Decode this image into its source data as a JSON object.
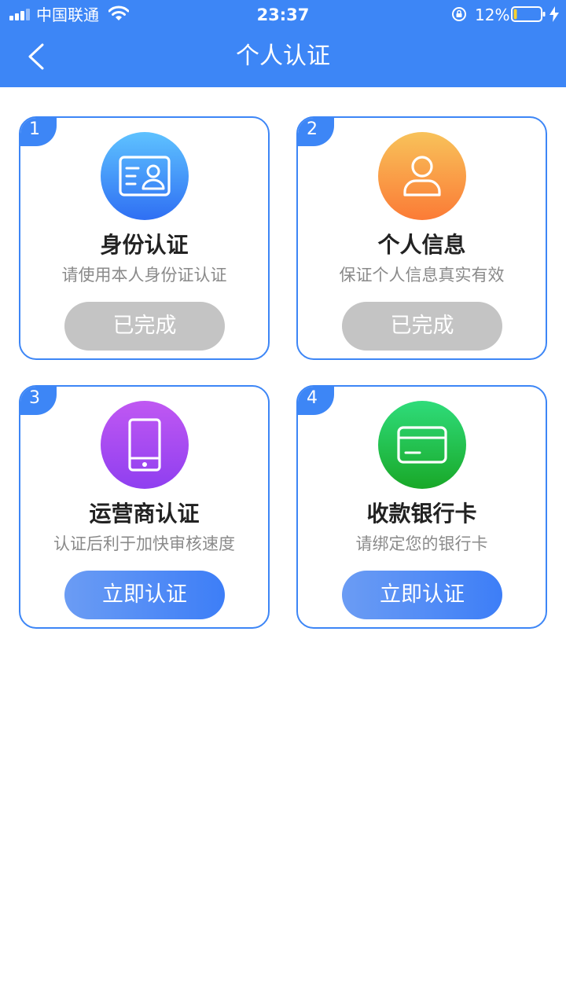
{
  "status_bar": {
    "carrier": "中国联通",
    "time": "23:37",
    "battery_percent": "12%",
    "battery_level": 0.12,
    "icons": [
      "signal-icon",
      "wifi-icon",
      "rotation-lock-icon",
      "battery-icon",
      "charging-icon"
    ]
  },
  "nav": {
    "back_icon": "chevron-left-icon",
    "title": "个人认证"
  },
  "colors": {
    "primary": "#3d86f6",
    "done_button": "#c4c4c4",
    "title_text": "#222222",
    "desc_text": "#8a8a8a"
  },
  "cards": [
    {
      "number": "1",
      "icon": "id-card-icon",
      "title": "身份认证",
      "description": "请使用本人身份证认证",
      "button": "已完成",
      "status": "done"
    },
    {
      "number": "2",
      "icon": "person-icon",
      "title": "个人信息",
      "description": "保证个人信息真实有效",
      "button": "已完成",
      "status": "done"
    },
    {
      "number": "3",
      "icon": "phone-icon",
      "title": "运营商认证",
      "description": "认证后利于加快审核速度",
      "button": "立即认证",
      "status": "pending"
    },
    {
      "number": "4",
      "icon": "bank-card-icon",
      "title": "收款银行卡",
      "description": "请绑定您的银行卡",
      "button": "立即认证",
      "status": "pending"
    }
  ]
}
